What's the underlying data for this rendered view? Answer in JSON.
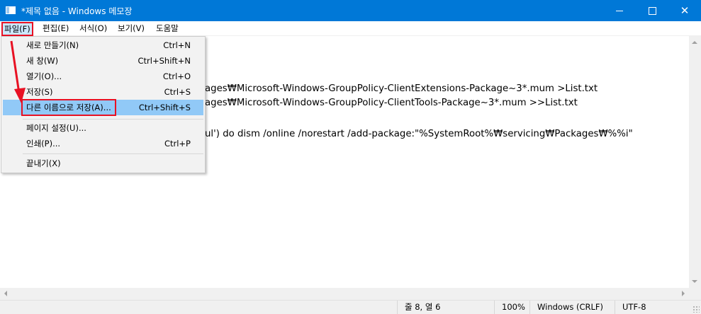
{
  "window": {
    "title": "*제목 없음 - Windows 메모장",
    "icon": "notepad-icon",
    "controls": {
      "minimize": "minimize-icon",
      "maximize": "maximize-icon",
      "close": "✕"
    },
    "accent": "#0078d7"
  },
  "menubar": {
    "file": "파일(F)",
    "edit": "편집(E)",
    "format": "서식(O)",
    "view": "보기(V)",
    "help": "도움말"
  },
  "file_menu": {
    "items": [
      {
        "label": "새로 만들기(N)",
        "shortcut": "Ctrl+N"
      },
      {
        "label": "새 창(W)",
        "shortcut": "Ctrl+Shift+N"
      },
      {
        "label": "열기(O)...",
        "shortcut": "Ctrl+O"
      },
      {
        "label": "저장(S)",
        "shortcut": "Ctrl+S"
      },
      {
        "label": "다른 이름으로 저장(A)...",
        "shortcut": "Ctrl+Shift+S"
      },
      {
        "label": "페이지 설정(U)...",
        "shortcut": ""
      },
      {
        "label": "인쇄(P)...",
        "shortcut": "Ctrl+P"
      },
      {
        "label": "끝내기(X)",
        "shortcut": ""
      }
    ],
    "highlighted": "다른 이름으로 저장(A)..."
  },
  "editor": {
    "lines": [
      "ages₩Microsoft-Windows-GroupPolicy-ClientExtensions-Package~3*.mum >List.txt",
      "ages₩Microsoft-Windows-GroupPolicy-ClientTools-Package~3*.mum >>List.txt",
      "ul') do dism /online /norestart /add-package:\"%SystemRoot%₩servicing₩Packages₩%%i\""
    ]
  },
  "statusbar": {
    "position": "줄 8, 열 6",
    "zoom": "100%",
    "line_ending": "Windows (CRLF)",
    "encoding": "UTF-8"
  },
  "annotation_color": "#e81123"
}
